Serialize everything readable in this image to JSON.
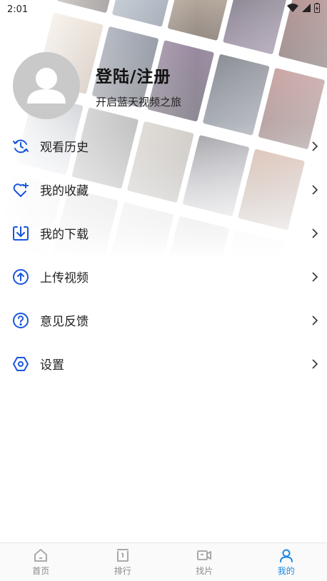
{
  "status_bar": {
    "time": "2:01"
  },
  "profile": {
    "title": "登陆/注册",
    "subtitle": "开启蓝天视频之旅"
  },
  "menu": {
    "items": [
      {
        "label": "观看历史",
        "icon": "history-icon"
      },
      {
        "label": "我的收藏",
        "icon": "heart-plus-icon"
      },
      {
        "label": "我的下载",
        "icon": "download-icon"
      },
      {
        "label": "上传视频",
        "icon": "upload-icon"
      },
      {
        "label": "意见反馈",
        "icon": "help-icon"
      },
      {
        "label": "设置",
        "icon": "settings-icon"
      }
    ]
  },
  "bottom_nav": {
    "items": [
      {
        "label": "首页",
        "icon": "home-icon"
      },
      {
        "label": "排行",
        "icon": "ranking-icon"
      },
      {
        "label": "找片",
        "icon": "video-camera-icon"
      },
      {
        "label": "我的",
        "icon": "user-icon"
      }
    ],
    "active_index": 3
  },
  "colors": {
    "accent": "#1e88e5",
    "icon_blue": "#1a56db",
    "inactive": "#a0a0a0"
  }
}
